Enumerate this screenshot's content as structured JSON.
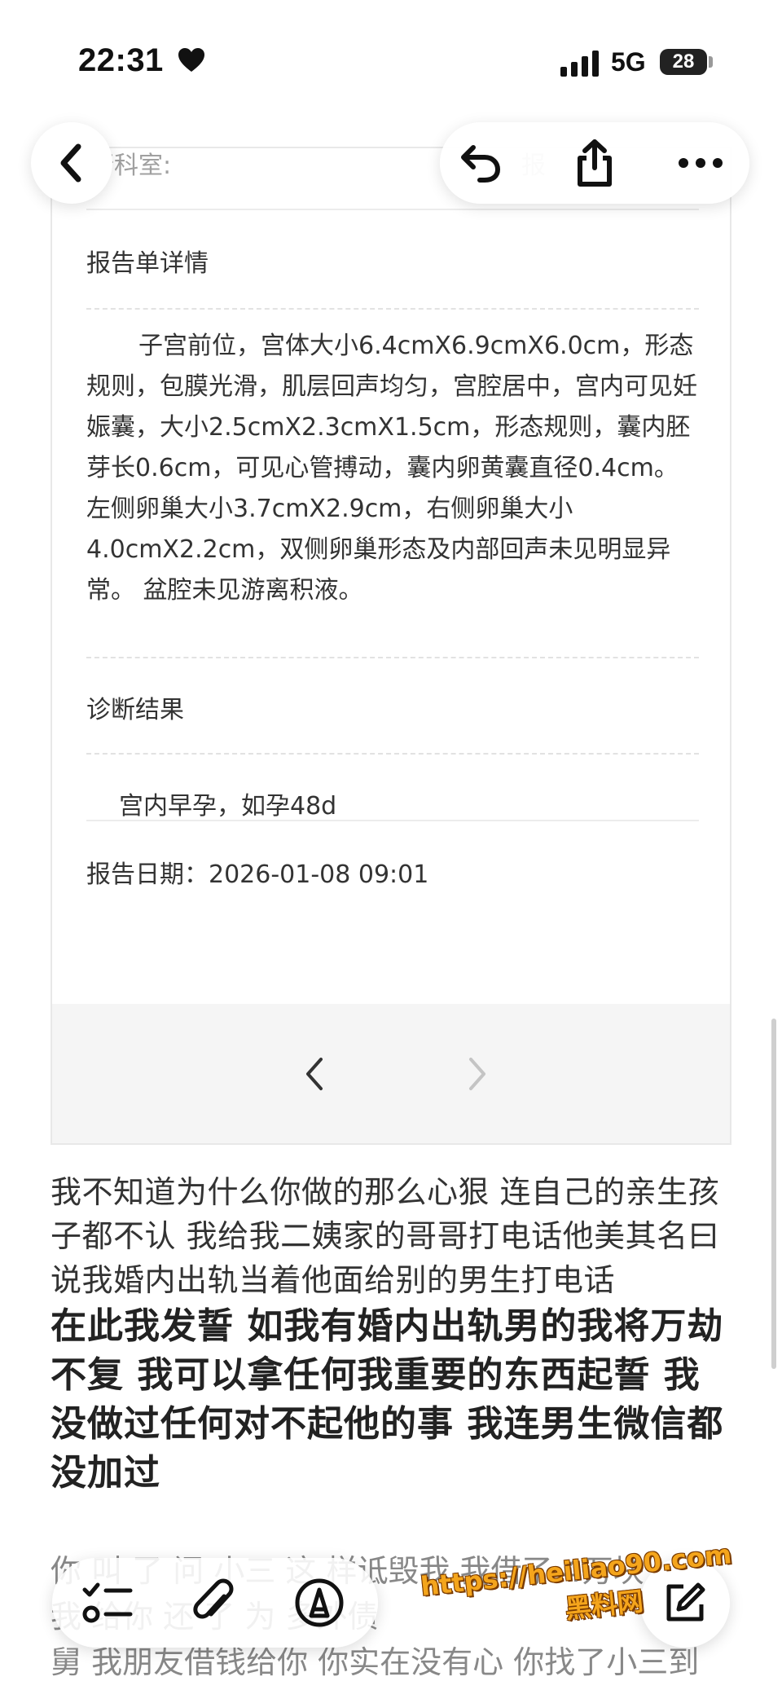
{
  "status_bar": {
    "time": "22:31",
    "network": "5G",
    "battery": "28"
  },
  "header": {
    "dept_label": "行科室:",
    "dept_label_right": "报"
  },
  "report": {
    "details_title": "报告单详情",
    "details_body": "子宫前位，宫体大小6.4cmX6.9cmX6.0cm，形态规则，包膜光滑，肌层回声均匀，宫腔居中，宫内可见妊娠囊，大小2.5cmX2.3cmX1.5cm，形态规则，囊内胚芽长0.6cm，可见心管搏动，囊内卵黄囊直径0.4cm。 左侧卵巢大小3.7cmX2.9cm，右侧卵巢大小4.0cmX2.2cm，双侧卵巢形态及内部回声未见明显异常。 盆腔未见游离积液。",
    "diagnosis_title": "诊断结果",
    "diagnosis_text": "宫内早孕，如孕48d",
    "date_label": "报告日期：2026-01-08 09:01"
  },
  "post": {
    "para1": "我不知道为什么你做的那么心狠 连自己的亲生孩子都不认 我给我二姨家的哥哥打电话他美其名曰说我婚内出轨当着他面给别的男生打电话",
    "para2_bold": "在此我发誓 如我有婚内出轨男的我将万劫不复 我可以拿任何我重要的东西起誓 我没做过任何对不起他的事 我连男生微信都没加过",
    "line_a": "你 叫 了 问 小三 这 样诋毁我 我借了 4万块",
    "line_b": "我 给你 还 了 为 多外债",
    "line_c": "舅 我朋友借钱给你 你实在没有心 你找了小三到"
  },
  "watermark": {
    "url": "https://heiliao90.com",
    "name": "黑料网"
  },
  "icons": [
    "back-icon",
    "undo-icon",
    "share-icon",
    "more-icon",
    "checklist-icon",
    "attachment-icon",
    "markup-icon",
    "compose-icon",
    "chevron-left-icon",
    "chevron-right-icon",
    "heart-icon",
    "signal-icon"
  ]
}
